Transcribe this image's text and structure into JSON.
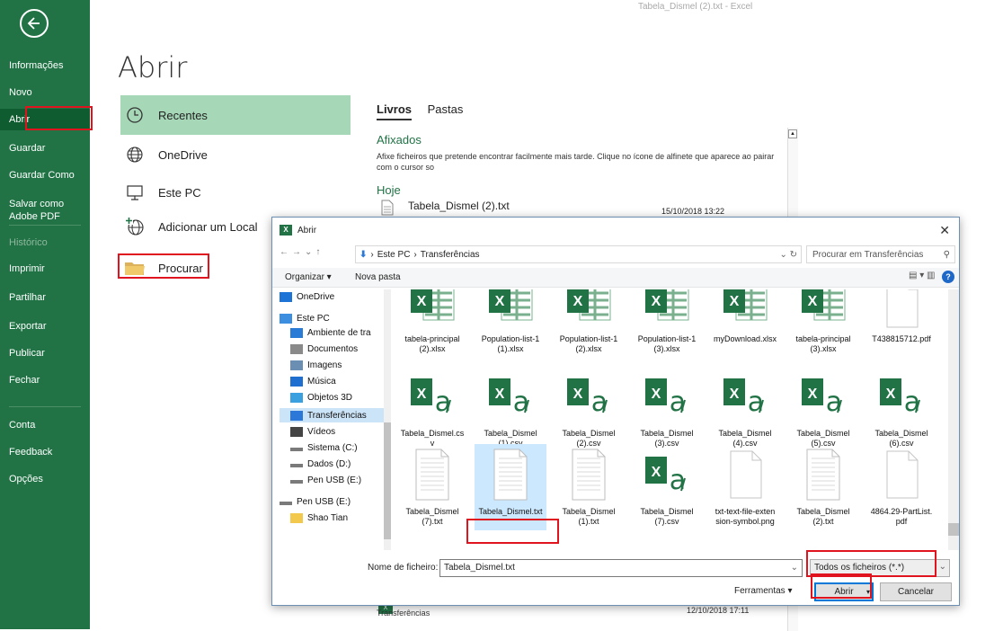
{
  "window_title": "Tabela_Dismel (2).txt  -  Excel",
  "backstage": {
    "items": [
      {
        "label": "Informações",
        "state": "normal"
      },
      {
        "label": "Novo",
        "state": "normal"
      },
      {
        "label": "Abrir",
        "state": "active"
      },
      {
        "label": "Guardar",
        "state": "normal"
      },
      {
        "label": "Guardar Como",
        "state": "normal"
      },
      {
        "label": "Salvar como\nAdobe PDF",
        "state": "normal"
      },
      {
        "label": "Histórico",
        "state": "disabled"
      },
      {
        "label": "Imprimir",
        "state": "normal"
      },
      {
        "label": "Partilhar",
        "state": "normal"
      },
      {
        "label": "Exportar",
        "state": "normal"
      },
      {
        "label": "Publicar",
        "state": "normal"
      },
      {
        "label": "Fechar",
        "state": "normal"
      },
      {
        "label": "Conta",
        "state": "normal"
      },
      {
        "label": "Feedback",
        "state": "normal"
      },
      {
        "label": "Opções",
        "state": "normal"
      }
    ],
    "colors": {
      "bg": "#217346",
      "active": "#0e5c2f"
    }
  },
  "page_title": "Abrir",
  "locations": [
    {
      "label": "Recentes",
      "icon": "clock-icon"
    },
    {
      "label": "OneDrive",
      "icon": "globe-icon"
    },
    {
      "label": "Este PC",
      "icon": "computer-icon"
    },
    {
      "label": "Adicionar um Local",
      "icon": "add-location-icon"
    },
    {
      "label": "Procurar",
      "icon": "folder-icon"
    }
  ],
  "recent_tabs": [
    "Livros",
    "Pastas"
  ],
  "pinned": {
    "heading": "Afixados",
    "text": "Afixe ficheiros que pretende encontrar facilmente mais tarde. Clique no ícone de alfinete que aparece ao pairar com o cursor so"
  },
  "today": {
    "heading": "Hoje",
    "file": "Tabela_Dismel (2).txt",
    "date": "15/10/2018 13:22"
  },
  "below_dialog": {
    "date": "12/10/2018 17:11",
    "path": "Transferências"
  },
  "dialog": {
    "title": "Abrir",
    "breadcrumb": [
      "Este PC",
      "Transferências"
    ],
    "search_placeholder": "Procurar em Transferências",
    "organize": "Organizar ▾",
    "new_folder": "Nova pasta",
    "nav": [
      {
        "label": "OneDrive",
        "icon": "cloud-icon",
        "level": 0
      },
      {
        "label": "Este PC",
        "icon": "computer-icon",
        "level": 0
      },
      {
        "label": "Ambiente de tra",
        "icon": "desktop-icon",
        "level": 1
      },
      {
        "label": "Documentos",
        "icon": "documents-icon",
        "level": 1
      },
      {
        "label": "Imagens",
        "icon": "pictures-icon",
        "level": 1
      },
      {
        "label": "Música",
        "icon": "music-icon",
        "level": 1
      },
      {
        "label": "Objetos 3D",
        "icon": "objects-3d-icon",
        "level": 1
      },
      {
        "label": "Transferências",
        "icon": "download-icon",
        "level": 1,
        "selected": true
      },
      {
        "label": "Vídeos",
        "icon": "videos-icon",
        "level": 1
      },
      {
        "label": "Sistema (C:)",
        "icon": "drive-icon",
        "level": 1
      },
      {
        "label": "Dados (D:)",
        "icon": "drive-icon",
        "level": 1
      },
      {
        "label": "Pen USB (E:)",
        "icon": "usb-drive-icon",
        "level": 1
      },
      {
        "label": "Pen USB (E:)",
        "icon": "usb-drive-icon",
        "level": 0
      },
      {
        "label": "Shao Tian",
        "icon": "folder-icon",
        "level": 1
      }
    ],
    "files": [
      {
        "name": "tabela-principal\n(2).xlsx",
        "type": "xlsx"
      },
      {
        "name": "Population-list-1\n(1).xlsx",
        "type": "xlsx"
      },
      {
        "name": "Population-list-1\n(2).xlsx",
        "type": "xlsx"
      },
      {
        "name": "Population-list-1\n(3).xlsx",
        "type": "xlsx"
      },
      {
        "name": "myDownload.xlsx",
        "type": "xlsx"
      },
      {
        "name": "tabela-principal\n(3).xlsx",
        "type": "xlsx"
      },
      {
        "name": "T438815712.pdf",
        "type": "blank"
      },
      {
        "name": "Tabela_Dismel.cs\nv",
        "type": "csv"
      },
      {
        "name": "Tabela_Dismel\n(1).csv",
        "type": "csv"
      },
      {
        "name": "Tabela_Dismel\n(2).csv",
        "type": "csv"
      },
      {
        "name": "Tabela_Dismel\n(3).csv",
        "type": "csv"
      },
      {
        "name": "Tabela_Dismel\n(4).csv",
        "type": "csv"
      },
      {
        "name": "Tabela_Dismel\n(5).csv",
        "type": "csv"
      },
      {
        "name": "Tabela_Dismel\n(6).csv",
        "type": "csv"
      },
      {
        "name": "Tabela_Dismel\n(7).txt",
        "type": "txt"
      },
      {
        "name": "Tabela_Dismel.txt",
        "type": "txt",
        "selected": true
      },
      {
        "name": "Tabela_Dismel\n(1).txt",
        "type": "txt"
      },
      {
        "name": "Tabela_Dismel\n(7).csv",
        "type": "csv"
      },
      {
        "name": "txt-text-file-exten\nsion-symbol.png",
        "type": "blank"
      },
      {
        "name": "Tabela_Dismel\n(2).txt",
        "type": "txt"
      },
      {
        "name": "4864.29-PartList.\npdf",
        "type": "blank"
      }
    ],
    "filename_label": "Nome de ficheiro:",
    "filename_value": "Tabela_Dismel.txt",
    "filter_value": "Todos os ficheiros (*.*)",
    "tools": "Ferramentas",
    "open": "Abrir",
    "cancel": "Cancelar"
  }
}
